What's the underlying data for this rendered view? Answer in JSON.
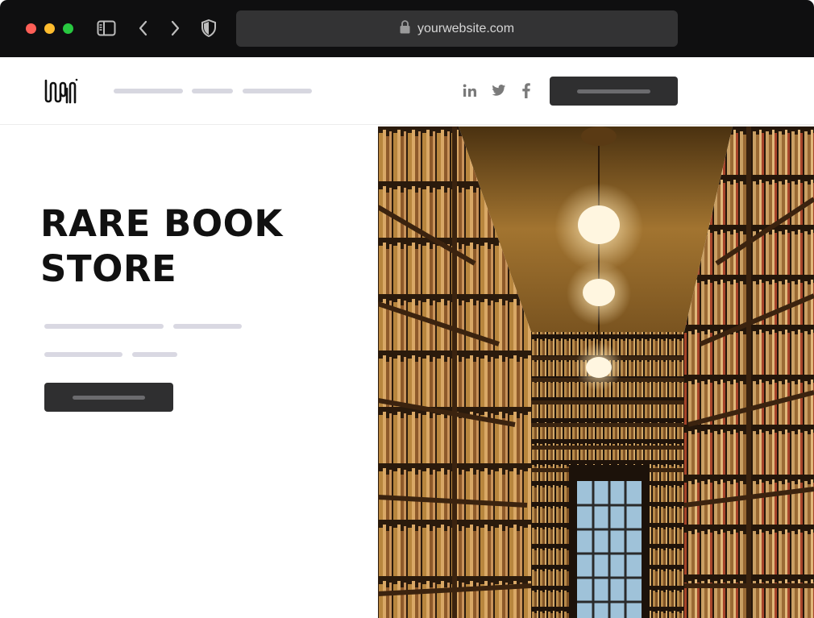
{
  "browser": {
    "url": "yourwebsite.com",
    "icons": [
      "sidebar-toggle-icon",
      "back-chevron-icon",
      "forward-chevron-icon",
      "shield-icon",
      "lock-icon"
    ]
  },
  "header": {
    "logo": "logo",
    "social": [
      "linkedin-icon",
      "twitter-icon",
      "facebook-icon"
    ]
  },
  "hero": {
    "title_line_1": "RARE BOOK",
    "title_line_2": "STORE",
    "image": "library-bookshelves-photo"
  },
  "colors": {
    "chrome_bg": "#0f0f10",
    "urlbar_bg": "#333334",
    "button_bg": "#2f2f30",
    "placeholder_pill": "#d9d8e2",
    "title_text": "#111111"
  }
}
